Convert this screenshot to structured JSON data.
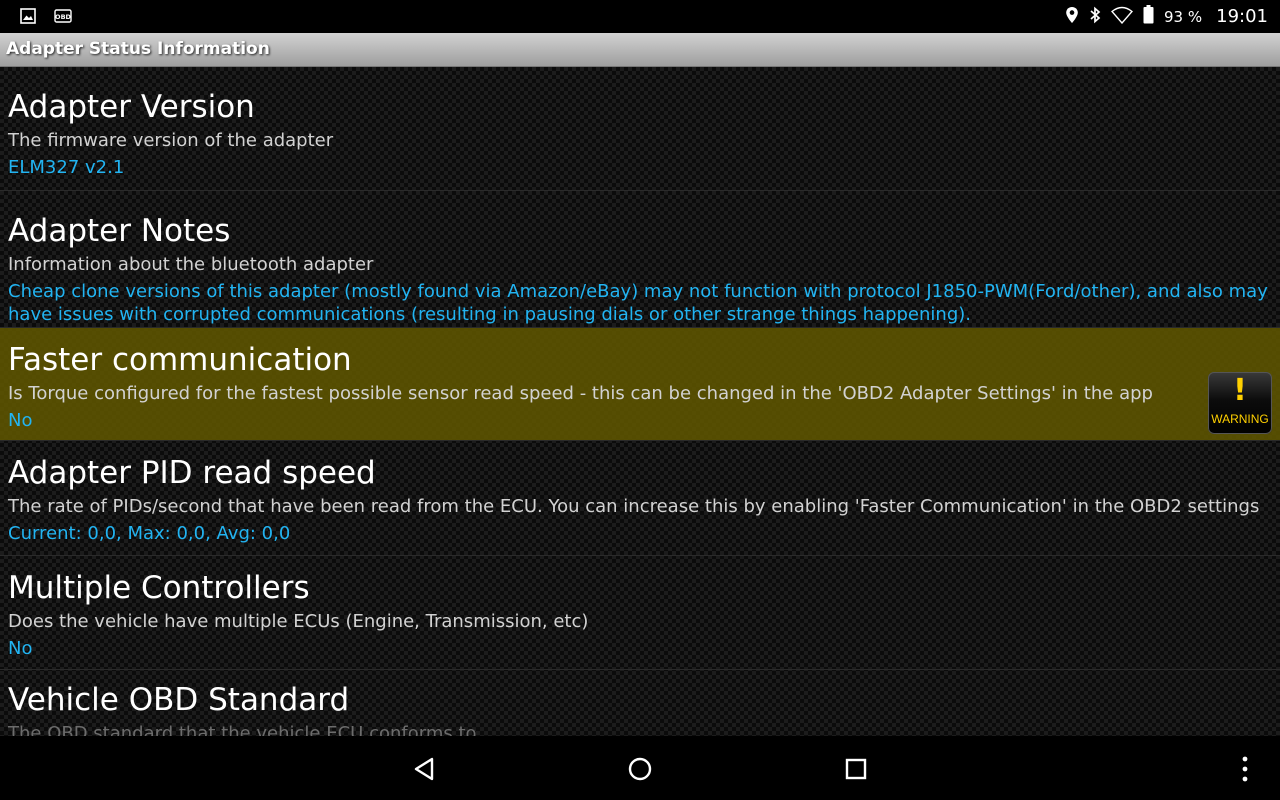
{
  "status_bar": {
    "notification_icons": [
      "image-icon",
      "obd-app-icon"
    ],
    "obd_icon_text": "OBD",
    "system_icons": [
      "location-icon",
      "bluetooth-icon",
      "wifi-icon",
      "battery-icon"
    ],
    "battery_percent": "93 %",
    "time": "19:01"
  },
  "title_bar": {
    "title": "Adapter Status Information"
  },
  "rows": [
    {
      "title": "Adapter Version",
      "description": "The firmware version of the adapter",
      "value": "ELM327 v2.1"
    },
    {
      "title": "Adapter Notes",
      "description": "Information about the bluetooth adapter",
      "value": "Cheap clone versions of this adapter (mostly found via Amazon/eBay) may not function with protocol J1850-PWM(Ford/other), and also may have issues with corrupted communications (resulting in pausing dials or other strange things happening)."
    },
    {
      "title": "Faster communication",
      "description": "Is Torque configured for the fastest possible sensor read speed - this can be changed in the 'OBD2 Adapter Settings' in the app",
      "value": "No",
      "highlighted": true,
      "badge": {
        "icon": "warning-icon",
        "label": "WARNING"
      }
    },
    {
      "title": "Adapter PID read speed",
      "description": "The rate of PIDs/second that have been read from the ECU. You can increase this by enabling 'Faster Communication' in the OBD2 settings",
      "value": "Current: 0,0, Max: 0,0, Avg: 0,0"
    },
    {
      "title": "Multiple Controllers",
      "description": "Does the vehicle have multiple ECUs (Engine, Transmission, etc)",
      "value": "No"
    },
    {
      "title": "Vehicle OBD Standard",
      "description": "The OBD standard that the vehicle ECU conforms to"
    }
  ],
  "nav_bar": {
    "buttons": [
      "back-icon",
      "home-icon",
      "recents-icon",
      "overflow-menu-icon"
    ]
  },
  "colors": {
    "value_text": "#22b4f2",
    "highlight_row": "#5f5500",
    "warning_yellow": "#ffd000"
  }
}
